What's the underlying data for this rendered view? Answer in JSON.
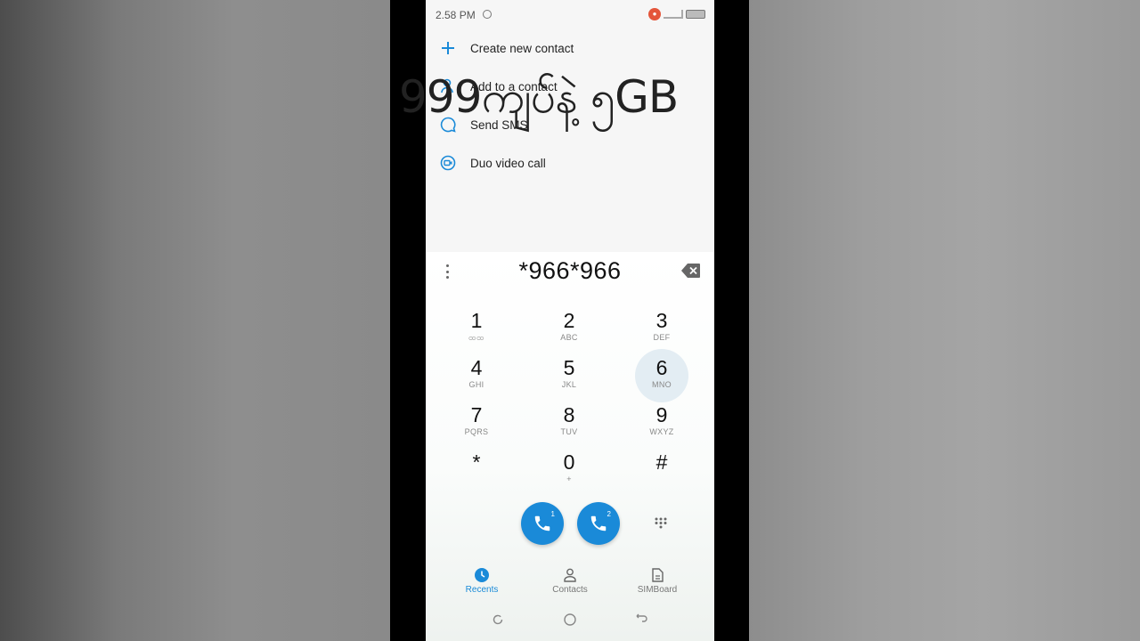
{
  "status_bar": {
    "time": "2.58 PM"
  },
  "options": [
    {
      "label": "Create new contact",
      "icon": "plus-icon"
    },
    {
      "label": "Add to a contact",
      "icon": "person-add-icon"
    },
    {
      "label": "Send SMS",
      "icon": "chat-bubble-icon"
    },
    {
      "label": "Duo video call",
      "icon": "duo-icon"
    }
  ],
  "overlay": {
    "text": "999ကျပ်နဲ့ ၅GB"
  },
  "dialer": {
    "number": "*966*966",
    "keys": [
      {
        "digit": "1",
        "letters": "ထထ"
      },
      {
        "digit": "2",
        "letters": "ABC"
      },
      {
        "digit": "3",
        "letters": "DEF"
      },
      {
        "digit": "4",
        "letters": "GHI"
      },
      {
        "digit": "5",
        "letters": "JKL"
      },
      {
        "digit": "6",
        "letters": "MNO"
      },
      {
        "digit": "7",
        "letters": "PQRS"
      },
      {
        "digit": "8",
        "letters": "TUV"
      },
      {
        "digit": "9",
        "letters": "WXYZ"
      },
      {
        "digit": "*",
        "letters": ""
      },
      {
        "digit": "0",
        "letters": "+"
      },
      {
        "digit": "#",
        "letters": ""
      }
    ],
    "call_buttons": [
      {
        "sim": "1"
      },
      {
        "sim": "2"
      }
    ]
  },
  "bottom_nav": [
    {
      "label": "Recents",
      "icon": "clock-icon",
      "active": true
    },
    {
      "label": "Contacts",
      "icon": "person-icon",
      "active": false
    },
    {
      "label": "SIMBoard",
      "icon": "sim-card-icon",
      "active": false
    }
  ],
  "colors": {
    "accent": "#1a8ad8",
    "record_indicator": "#e4553a"
  }
}
